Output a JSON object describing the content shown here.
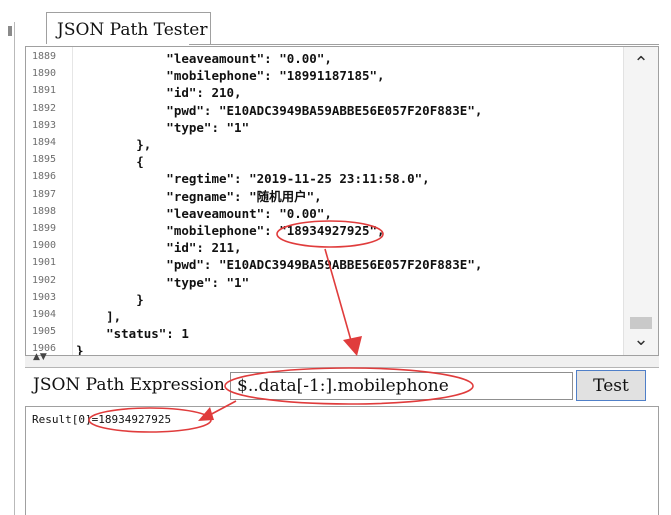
{
  "window": {
    "tab_title": "JSON Path Tester"
  },
  "editor": {
    "lines": [
      {
        "number": "1889",
        "code": "            \"leaveamount\": \"0.00\","
      },
      {
        "number": "1890",
        "code": "            \"mobilephone\": \"18991187185\","
      },
      {
        "number": "1891",
        "code": "            \"id\": 210,"
      },
      {
        "number": "1892",
        "code": "            \"pwd\": \"E10ADC3949BA59ABBE56E057F20F883E\","
      },
      {
        "number": "1893",
        "code": "            \"type\": \"1\""
      },
      {
        "number": "1894",
        "code": "        },"
      },
      {
        "number": "1895",
        "code": "        {"
      },
      {
        "number": "1896",
        "code": "            \"regtime\": \"2019-11-25 23:11:58.0\","
      },
      {
        "number": "1897",
        "code": "            \"regname\": \"随机用户\","
      },
      {
        "number": "1898",
        "code": "            \"leaveamount\": \"0.00\","
      },
      {
        "number": "1899",
        "code": "            \"mobilephone\": \"18934927925\","
      },
      {
        "number": "1900",
        "code": "            \"id\": 211,"
      },
      {
        "number": "1901",
        "code": "            \"pwd\": \"E10ADC3949BA59ABBE56E057F20F883E\","
      },
      {
        "number": "1902",
        "code": "            \"type\": \"1\""
      },
      {
        "number": "1903",
        "code": "        }"
      },
      {
        "number": "1904",
        "code": "    ],"
      },
      {
        "number": "1905",
        "code": "    \"status\": 1"
      },
      {
        "number": "1906",
        "code": "}"
      }
    ],
    "scroll_up_icon": "chevron-up-icon",
    "scroll_down_icon": "chevron-down-icon"
  },
  "expression": {
    "label": "JSON Path Expression",
    "value": "$..data[-1:].mobilephone",
    "button_label": "Test"
  },
  "result": {
    "text": "Result[0]=18934927925"
  },
  "annotation": {
    "color": "#e03c3c"
  }
}
